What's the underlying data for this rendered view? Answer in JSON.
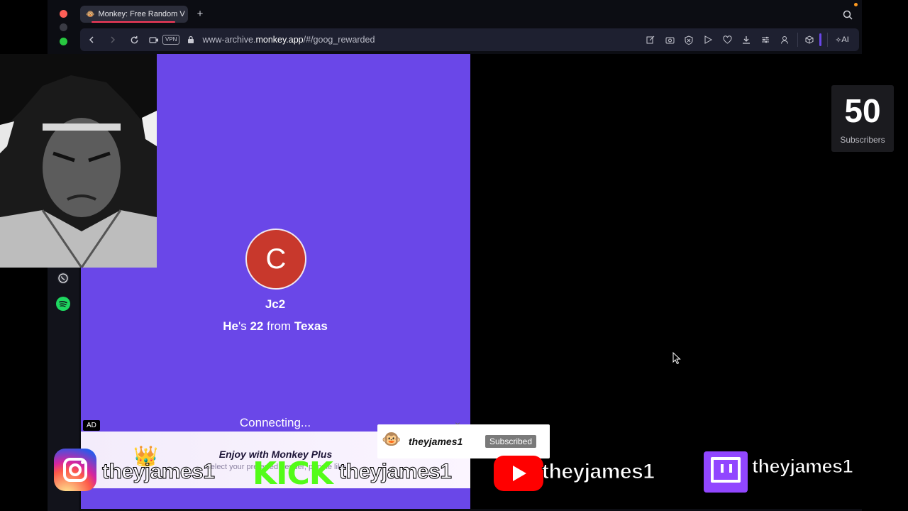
{
  "browser": {
    "tab_title": "Monkey: Free Random V",
    "url_prefix": "www-archive.",
    "url_host": "monkey.app",
    "url_path": "/#/goog_rewarded",
    "vpn_label": "VPN",
    "ai_label": "AI"
  },
  "match": {
    "avatar_initial": "C",
    "username": "Jc2",
    "pronoun": "He",
    "verb": "'s",
    "age": "22",
    "from_word": "from",
    "location": "Texas",
    "status": "Connecting..."
  },
  "ad": {
    "badge": "AD",
    "title": "Enjoy with Monkey Plus",
    "subtitle": "Select your preferred gender, people like",
    "close": "×"
  },
  "overlay": {
    "subscriber_count": "50",
    "subscriber_label": "Subscribers",
    "subscribed_name": "theyjames1",
    "subscribed_button": "Subscribed",
    "handle_instagram": "theyjames1",
    "handle_kick": "theyjames1",
    "handle_youtube": "theyjames1",
    "handle_twitch": "theyjames1",
    "kick_label": "KICK"
  },
  "icons": [
    "whatsapp-icon",
    "spotify-icon",
    "instagram-icon",
    "youtube-icon",
    "twitch-icon"
  ],
  "colors": {
    "purple_panel": "#6a47e8",
    "avatar_bg": "#c8382c",
    "kick_green": "#53fc18",
    "youtube_red": "#ff0000",
    "twitch_purple": "#9146ff"
  }
}
